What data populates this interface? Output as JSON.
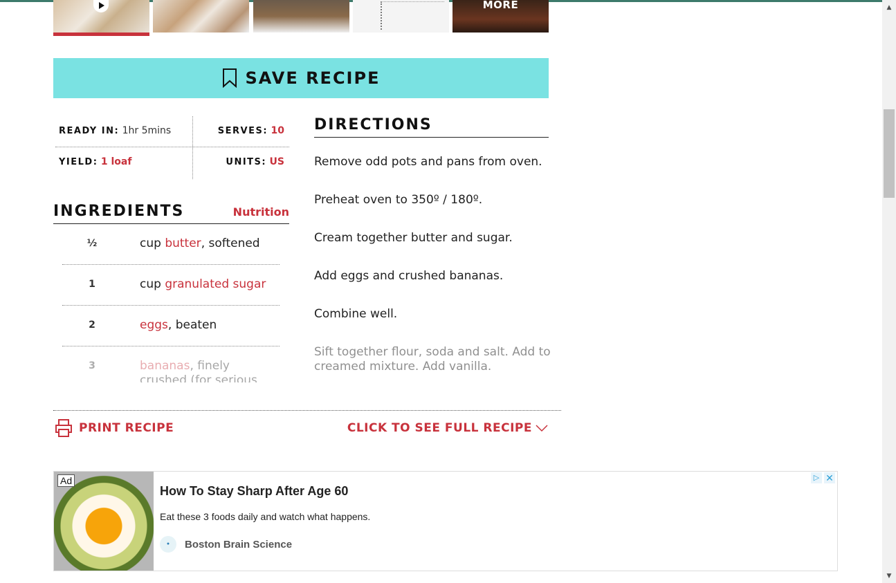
{
  "thumbnails": {
    "more_label": "MORE"
  },
  "save_recipe": {
    "label": "SAVE RECIPE"
  },
  "info": {
    "ready_key": "READY IN:",
    "ready_val": "1hr 5mins",
    "serves_key": "SERVES:",
    "serves_val": "10",
    "yield_key": "YIELD:",
    "yield_val": "1 loaf",
    "units_key": "UNITS:",
    "units_val": "US"
  },
  "ingredients": {
    "title": "INGREDIENTS",
    "nutrition_link": "Nutrition",
    "items": [
      {
        "qty": "½",
        "unit": "cup",
        "name": "butter",
        "rest": ", softened"
      },
      {
        "qty": "1",
        "unit": "cup",
        "name": "granulated sugar",
        "rest": ""
      },
      {
        "qty": "2",
        "unit": "",
        "name": "eggs",
        "rest": ", beaten"
      },
      {
        "qty": "3",
        "unit": "",
        "name": "bananas",
        "rest": ", finely crushed (for serious"
      }
    ]
  },
  "directions": {
    "title": "DIRECTIONS",
    "steps": [
      "Remove odd pots and pans from oven.",
      "Preheat oven to 350º / 180º.",
      "Cream together butter and sugar.",
      "Add eggs and crushed bananas.",
      "Combine well.",
      "Sift together flour, soda and salt. Add to creamed mixture. Add vanilla."
    ]
  },
  "actions": {
    "print_label": "PRINT RECIPE",
    "full_recipe_label": "CLICK TO SEE FULL RECIPE"
  },
  "ad": {
    "badge": "Ad",
    "headline": "How To Stay Sharp After Age 60",
    "subtext": "Eat these 3 foods daily and watch what happens.",
    "brand": "Boston Brain Science"
  },
  "colors": {
    "accent": "#c8323c",
    "save_bg": "#7ae2e2"
  }
}
